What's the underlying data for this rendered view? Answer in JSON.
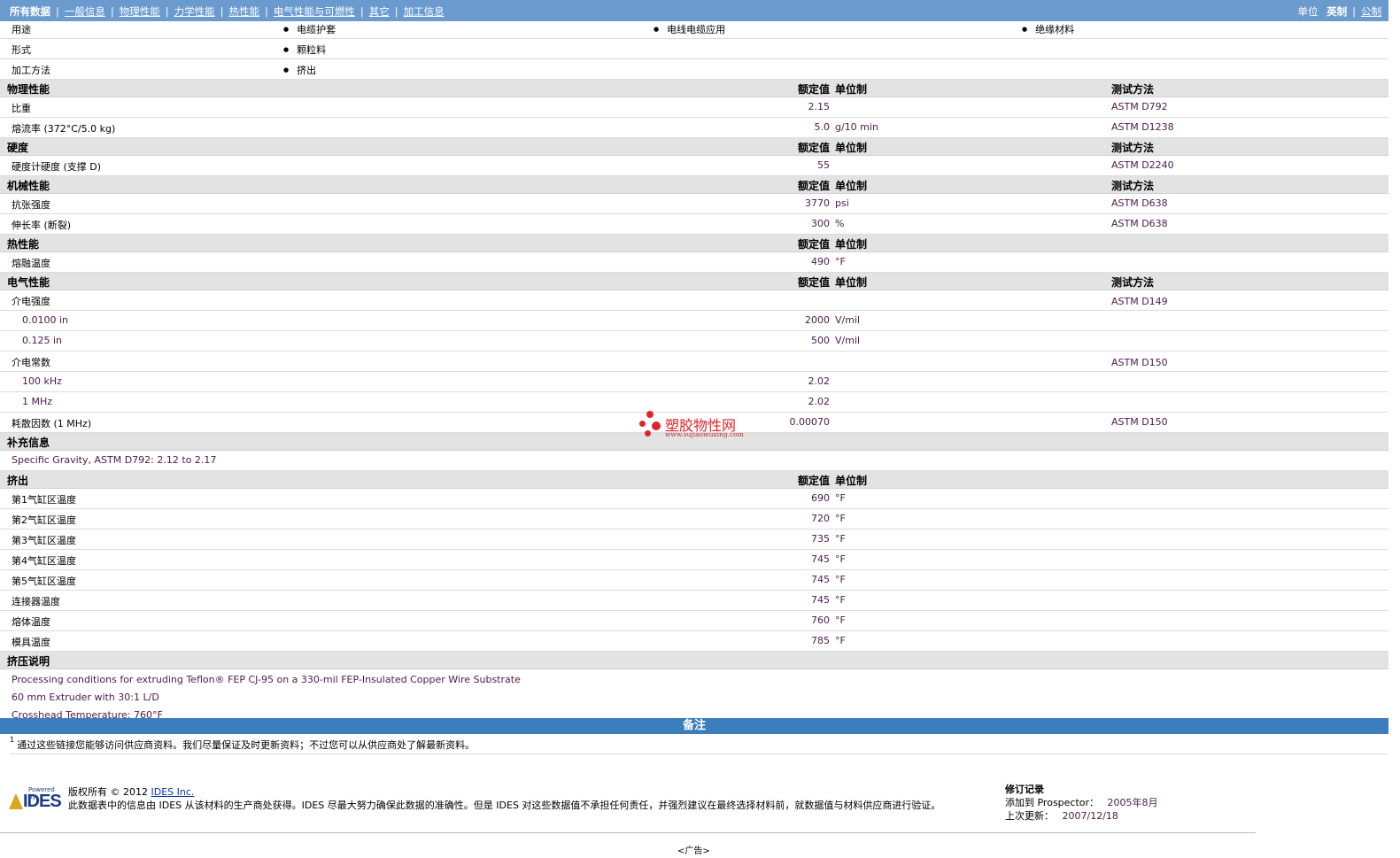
{
  "nav": {
    "items": [
      "所有数据",
      "一般信息",
      "物理性能",
      "力学性能",
      "热性能",
      "电气性能与可燃性",
      "其它",
      "加工信息"
    ],
    "unit_label": "单位",
    "unit_english": "英制",
    "unit_metric": "公制"
  },
  "general": [
    {
      "label": "用途",
      "values": [
        "电缆护套",
        "电线电缆应用",
        "绝缘材料"
      ]
    },
    {
      "label": "形式",
      "values": [
        "颗粒料"
      ]
    },
    {
      "label": "加工方法",
      "values": [
        "挤出"
      ]
    }
  ],
  "columns": {
    "value": "额定值",
    "unit": "单位制",
    "test": "测试方法"
  },
  "sections": {
    "physical": {
      "title": "物理性能",
      "rows": [
        {
          "name": "比重",
          "value": "2.15",
          "unit": "",
          "test": "ASTM D792"
        },
        {
          "name": "熔流率 (372°C/5.0 kg)",
          "value": "5.0",
          "unit": "g/10 min",
          "test": "ASTM D1238"
        }
      ]
    },
    "hardness": {
      "title": "硬度",
      "rows": [
        {
          "name": "硬度计硬度 (支撑 D)",
          "value": "55",
          "unit": "",
          "test": "ASTM D2240"
        }
      ]
    },
    "mechanical": {
      "title": "机械性能",
      "rows": [
        {
          "name": "抗张强度",
          "value": "3770",
          "unit": "psi",
          "test": "ASTM D638"
        },
        {
          "name": "伸长率 (断裂)",
          "value": "300",
          "unit": "%",
          "test": "ASTM D638"
        }
      ]
    },
    "thermal": {
      "title": "热性能",
      "rows": [
        {
          "name": "熔融温度",
          "value": "490",
          "unit": "°F",
          "test": ""
        }
      ]
    },
    "electrical": {
      "title": "电气性能",
      "rows": [
        {
          "name": "介电强度",
          "value": "",
          "unit": "",
          "test": "ASTM D149"
        },
        {
          "name": "0.0100 in",
          "value": "2000",
          "unit": "V/mil",
          "test": ""
        },
        {
          "name": "0.125 in",
          "value": "500",
          "unit": "V/mil",
          "test": ""
        },
        {
          "name": "介电常数",
          "value": "",
          "unit": "",
          "test": "ASTM D150"
        },
        {
          "name": "100 kHz",
          "value": "2.02",
          "unit": "",
          "test": ""
        },
        {
          "name": "1 MHz",
          "value": "2.02",
          "unit": "",
          "test": ""
        },
        {
          "name": "耗散因数 (1 MHz)",
          "value": "0.00070",
          "unit": "",
          "test": "ASTM D150"
        }
      ]
    },
    "supplement": {
      "title": "补充信息",
      "text": "Specific Gravity, ASTM D792: 2.12 to 2.17"
    },
    "extrusion": {
      "title": "挤出",
      "rows": [
        {
          "name": "第1气缸区温度",
          "value": "690",
          "unit": "°F"
        },
        {
          "name": "第2气缸区温度",
          "value": "720",
          "unit": "°F"
        },
        {
          "name": "第3气缸区温度",
          "value": "735",
          "unit": "°F"
        },
        {
          "name": "第4气缸区温度",
          "value": "745",
          "unit": "°F"
        },
        {
          "name": "第5气缸区温度",
          "value": "745",
          "unit": "°F"
        },
        {
          "name": "连接器温度",
          "value": "745",
          "unit": "°F"
        },
        {
          "name": "熔体温度",
          "value": "760",
          "unit": "°F"
        },
        {
          "name": "模具温度",
          "value": "785",
          "unit": "°F"
        }
      ]
    },
    "extrusion_notes": {
      "title": "挤压说明",
      "lines": [
        "Processing conditions for extruding Teflon® FEP CJ-95 on a 330-mil FEP-Insulated Copper Wire Substrate",
        "60 mm Extruder with 30:1 L/D",
        "Crosshead Temperature: 760°F"
      ]
    }
  },
  "notes_bar": "备注",
  "footnote": {
    "marker": "1",
    "text": "通过这些链接您能够访问供应商资料。我们尽量保证及时更新资料；不过您可以从供应商处了解最新资料。"
  },
  "footer": {
    "logo_small": "Powered by",
    "logo_big": "IDES",
    "copyright_prefix": "版权所有 © 2012",
    "copyright_link": "IDES Inc.",
    "disclaimer": "此数据表中的信息由 IDES 从该材料的生产商处获得。IDES 尽最大努力确保此数据的准确性。但是 IDES 对这些数据值不承担任何责任，并强烈建议在最终选择材料前，就数据值与材料供应商进行验证。",
    "revision_title": "修订记录",
    "added_label": "添加到 Prospector：",
    "added_value": "2005年8月",
    "updated_label": "上次更新：",
    "updated_value": "2007/12/18"
  },
  "ad": "<广告>",
  "watermark": {
    "title": "塑胶物性网",
    "url": "www.sujiaowuxing.com"
  },
  "colors": {
    "nav_bg": "#6a9ace",
    "notes_bar": "#3b7dbd",
    "header_row": "#e3e3e3",
    "value_text": "#4a1a4a"
  }
}
